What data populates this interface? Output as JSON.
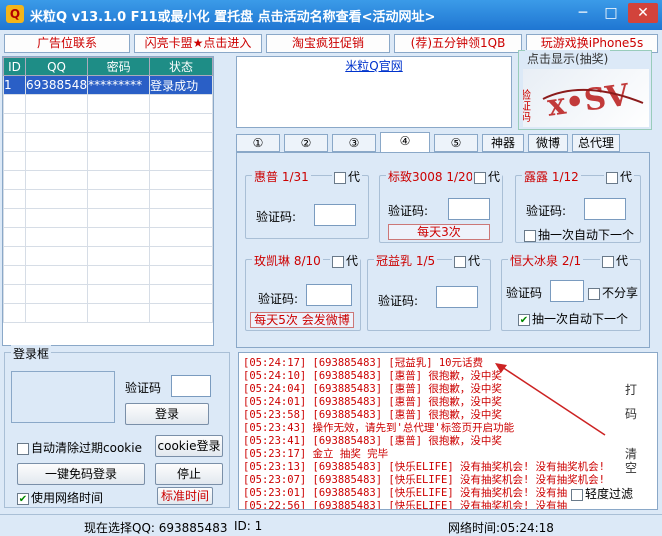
{
  "window": {
    "title": "米粒Q v13.1.0   F11或最小化 置托盘   点击活动名称查看<活动网址>",
    "min_icon": "─",
    "max_icon": "□",
    "close_icon": "✕",
    "app_icon": "Q"
  },
  "adbar": [
    "广告位联系",
    "闪亮卡盟★点击进入",
    "淘宝疯狂促销",
    "(荐)五分钟领1QB",
    "玩游戏换iPhone5s"
  ],
  "grid": {
    "headers": [
      "ID",
      "QQ",
      "密码",
      "状态"
    ],
    "rows": [
      [
        "1",
        "69388548",
        "*********",
        "登录成功"
      ]
    ]
  },
  "adbox": {
    "link": "米粒Q官网"
  },
  "lottery": {
    "title": "点击显示(抽奖)",
    "code_label": "验证码"
  },
  "tabs": [
    "①",
    "②",
    "③",
    "④",
    "⑤",
    "神器",
    "微博",
    "总代理"
  ],
  "active_tab": 3,
  "groups": {
    "g1": {
      "title": "惠普 1/31",
      "dai": "代",
      "label": "验证码:"
    },
    "g2": {
      "title": "标致3008 1/20",
      "dai": "代",
      "label": "验证码:",
      "tag": "每天3次"
    },
    "g3": {
      "title": "露露 1/12",
      "dai": "代",
      "label": "验证码:",
      "auto": "抽一次自动下一个"
    },
    "g4": {
      "title": "玫凯琳 8/10",
      "dai": "代",
      "label": "验证码:",
      "tag": "每天5次 会发微博"
    },
    "g5": {
      "title": "冠益乳 1/5",
      "dai": "代",
      "label": "验证码:"
    },
    "g6": {
      "title": "恒大冰泉 2/1",
      "dai": "代",
      "label": "验证码",
      "share": "不分享",
      "auto": "抽一次自动下一个"
    }
  },
  "login": {
    "title": "登录框",
    "code_label": "验证码",
    "login_btn": "登录",
    "auto_clear": "自动清除过期cookie",
    "cookie_login": "cookie登录",
    "one_key": "一键免码登录",
    "stop": "停止",
    "use_net_time": "使用网络时间",
    "std_time": "标准时间"
  },
  "log": [
    "[05:24:17] [693885483] [冠益乳] 10元话费",
    "[05:24:10] [693885483] [惠普] 很抱歉，没中奖",
    "[05:24:04] [693885483] [惠普] 很抱歉，没中奖",
    "[05:24:01] [693885483] [惠普] 很抱歉，没中奖",
    "[05:23:58] [693885483] [惠普] 很抱歉，没中奖",
    "[05:23:43] 操作无效，请先到'总代理'标签页开启功能",
    "[05:23:41] [693885483] [惠普] 很抱歉，没中奖",
    "[05:23:17] 金立 抽奖  完毕",
    "[05:23:13] [693885483] [快乐ELIFE] 没有抽奖机会! 没有抽奖机会!",
    "[05:23:07] [693885483] [快乐ELIFE] 没有抽奖机会! 没有抽奖机会!",
    "[05:23:01] [693885483] [快乐ELIFE] 没有抽奖机会! 没有抽",
    "[05:22:56] [693885483] [快乐ELIFE] 没有抽奖机会! 没有抽"
  ],
  "side": [
    "打",
    "码",
    "清",
    "空"
  ],
  "filter": "轻度过滤",
  "status": {
    "current": "现在选择QQ: 693885483",
    "id": "ID: 1",
    "net_time": "网络时间:05:24:18"
  },
  "colors": {
    "title_bar": "#1f76d2",
    "accent_red": "#cc0000",
    "grid_header": "#1e8d86",
    "selected_row": "#2a5fc6"
  }
}
